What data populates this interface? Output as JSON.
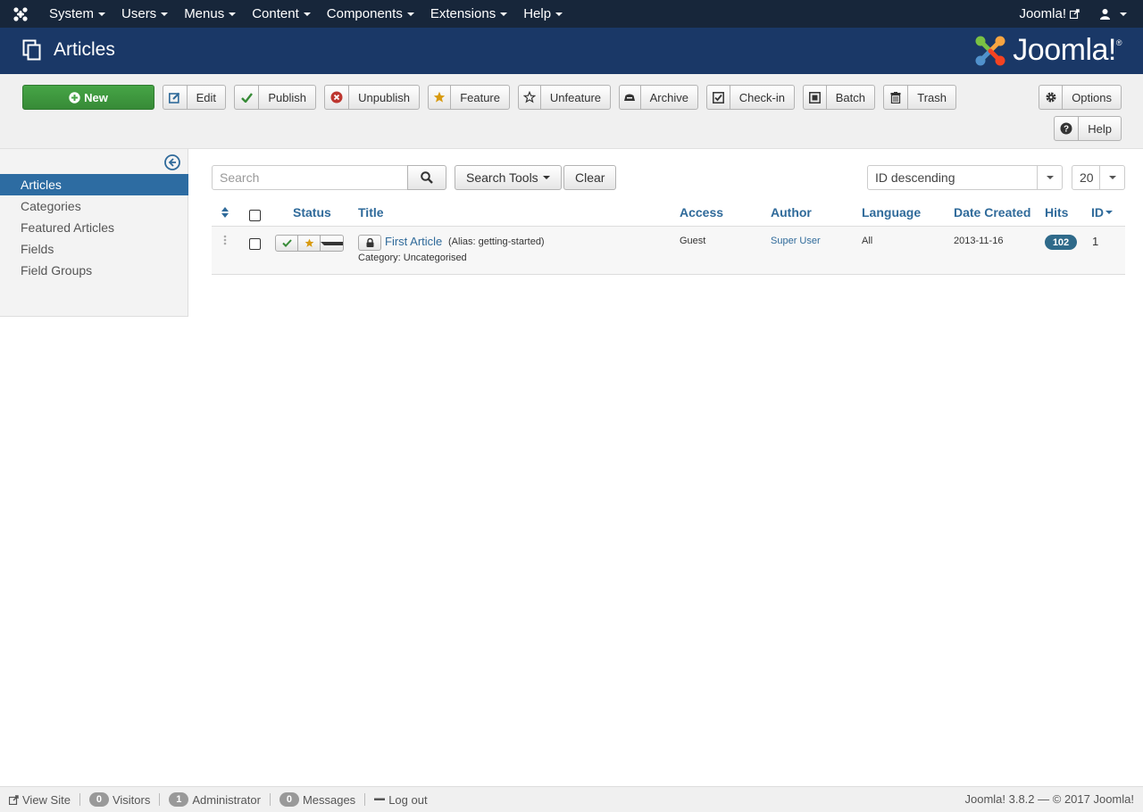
{
  "topnav": {
    "menu": [
      {
        "label": "System"
      },
      {
        "label": "Users"
      },
      {
        "label": "Menus"
      },
      {
        "label": "Content"
      },
      {
        "label": "Components"
      },
      {
        "label": "Extensions"
      },
      {
        "label": "Help"
      }
    ],
    "site_link": "Joomla!"
  },
  "header": {
    "title": "Articles",
    "brand": "Joomla!",
    "brand_mark": "®"
  },
  "toolbar": {
    "new": "New",
    "edit": "Edit",
    "publish": "Publish",
    "unpublish": "Unpublish",
    "feature": "Feature",
    "unfeature": "Unfeature",
    "archive": "Archive",
    "checkin": "Check-in",
    "batch": "Batch",
    "trash": "Trash",
    "options": "Options",
    "help": "Help"
  },
  "sidebar": {
    "items": [
      {
        "label": "Articles"
      },
      {
        "label": "Categories"
      },
      {
        "label": "Featured Articles"
      },
      {
        "label": "Fields"
      },
      {
        "label": "Field Groups"
      }
    ]
  },
  "filters": {
    "search_placeholder": "Search",
    "search_tools": "Search Tools",
    "clear": "Clear",
    "ordering": "ID descending",
    "limit": "20"
  },
  "table": {
    "columns": {
      "status": "Status",
      "title": "Title",
      "access": "Access",
      "author": "Author",
      "language": "Language",
      "date_created": "Date Created",
      "hits": "Hits",
      "id": "ID"
    },
    "rows": [
      {
        "title": "First Article",
        "alias": "(Alias: getting-started)",
        "category": "Category: Uncategorised",
        "access": "Guest",
        "author": "Super User",
        "language": "All",
        "date_created": "2013-11-16",
        "hits": "102",
        "id": "1"
      }
    ]
  },
  "footer": {
    "view_site": "View Site",
    "visitors_count": "0",
    "visitors": "Visitors",
    "admins_count": "1",
    "admins": "Administrator",
    "messages_count": "0",
    "messages": "Messages",
    "logout": "Log out",
    "version": "Joomla! 3.8.2 — © 2017 Joomla!"
  },
  "colors": {
    "topnav_bg": "#17263a",
    "header_bg": "#1a3867",
    "new_button": "#46a546",
    "link": "#2f6a9a",
    "sidebar_active": "#2d6ca2"
  }
}
